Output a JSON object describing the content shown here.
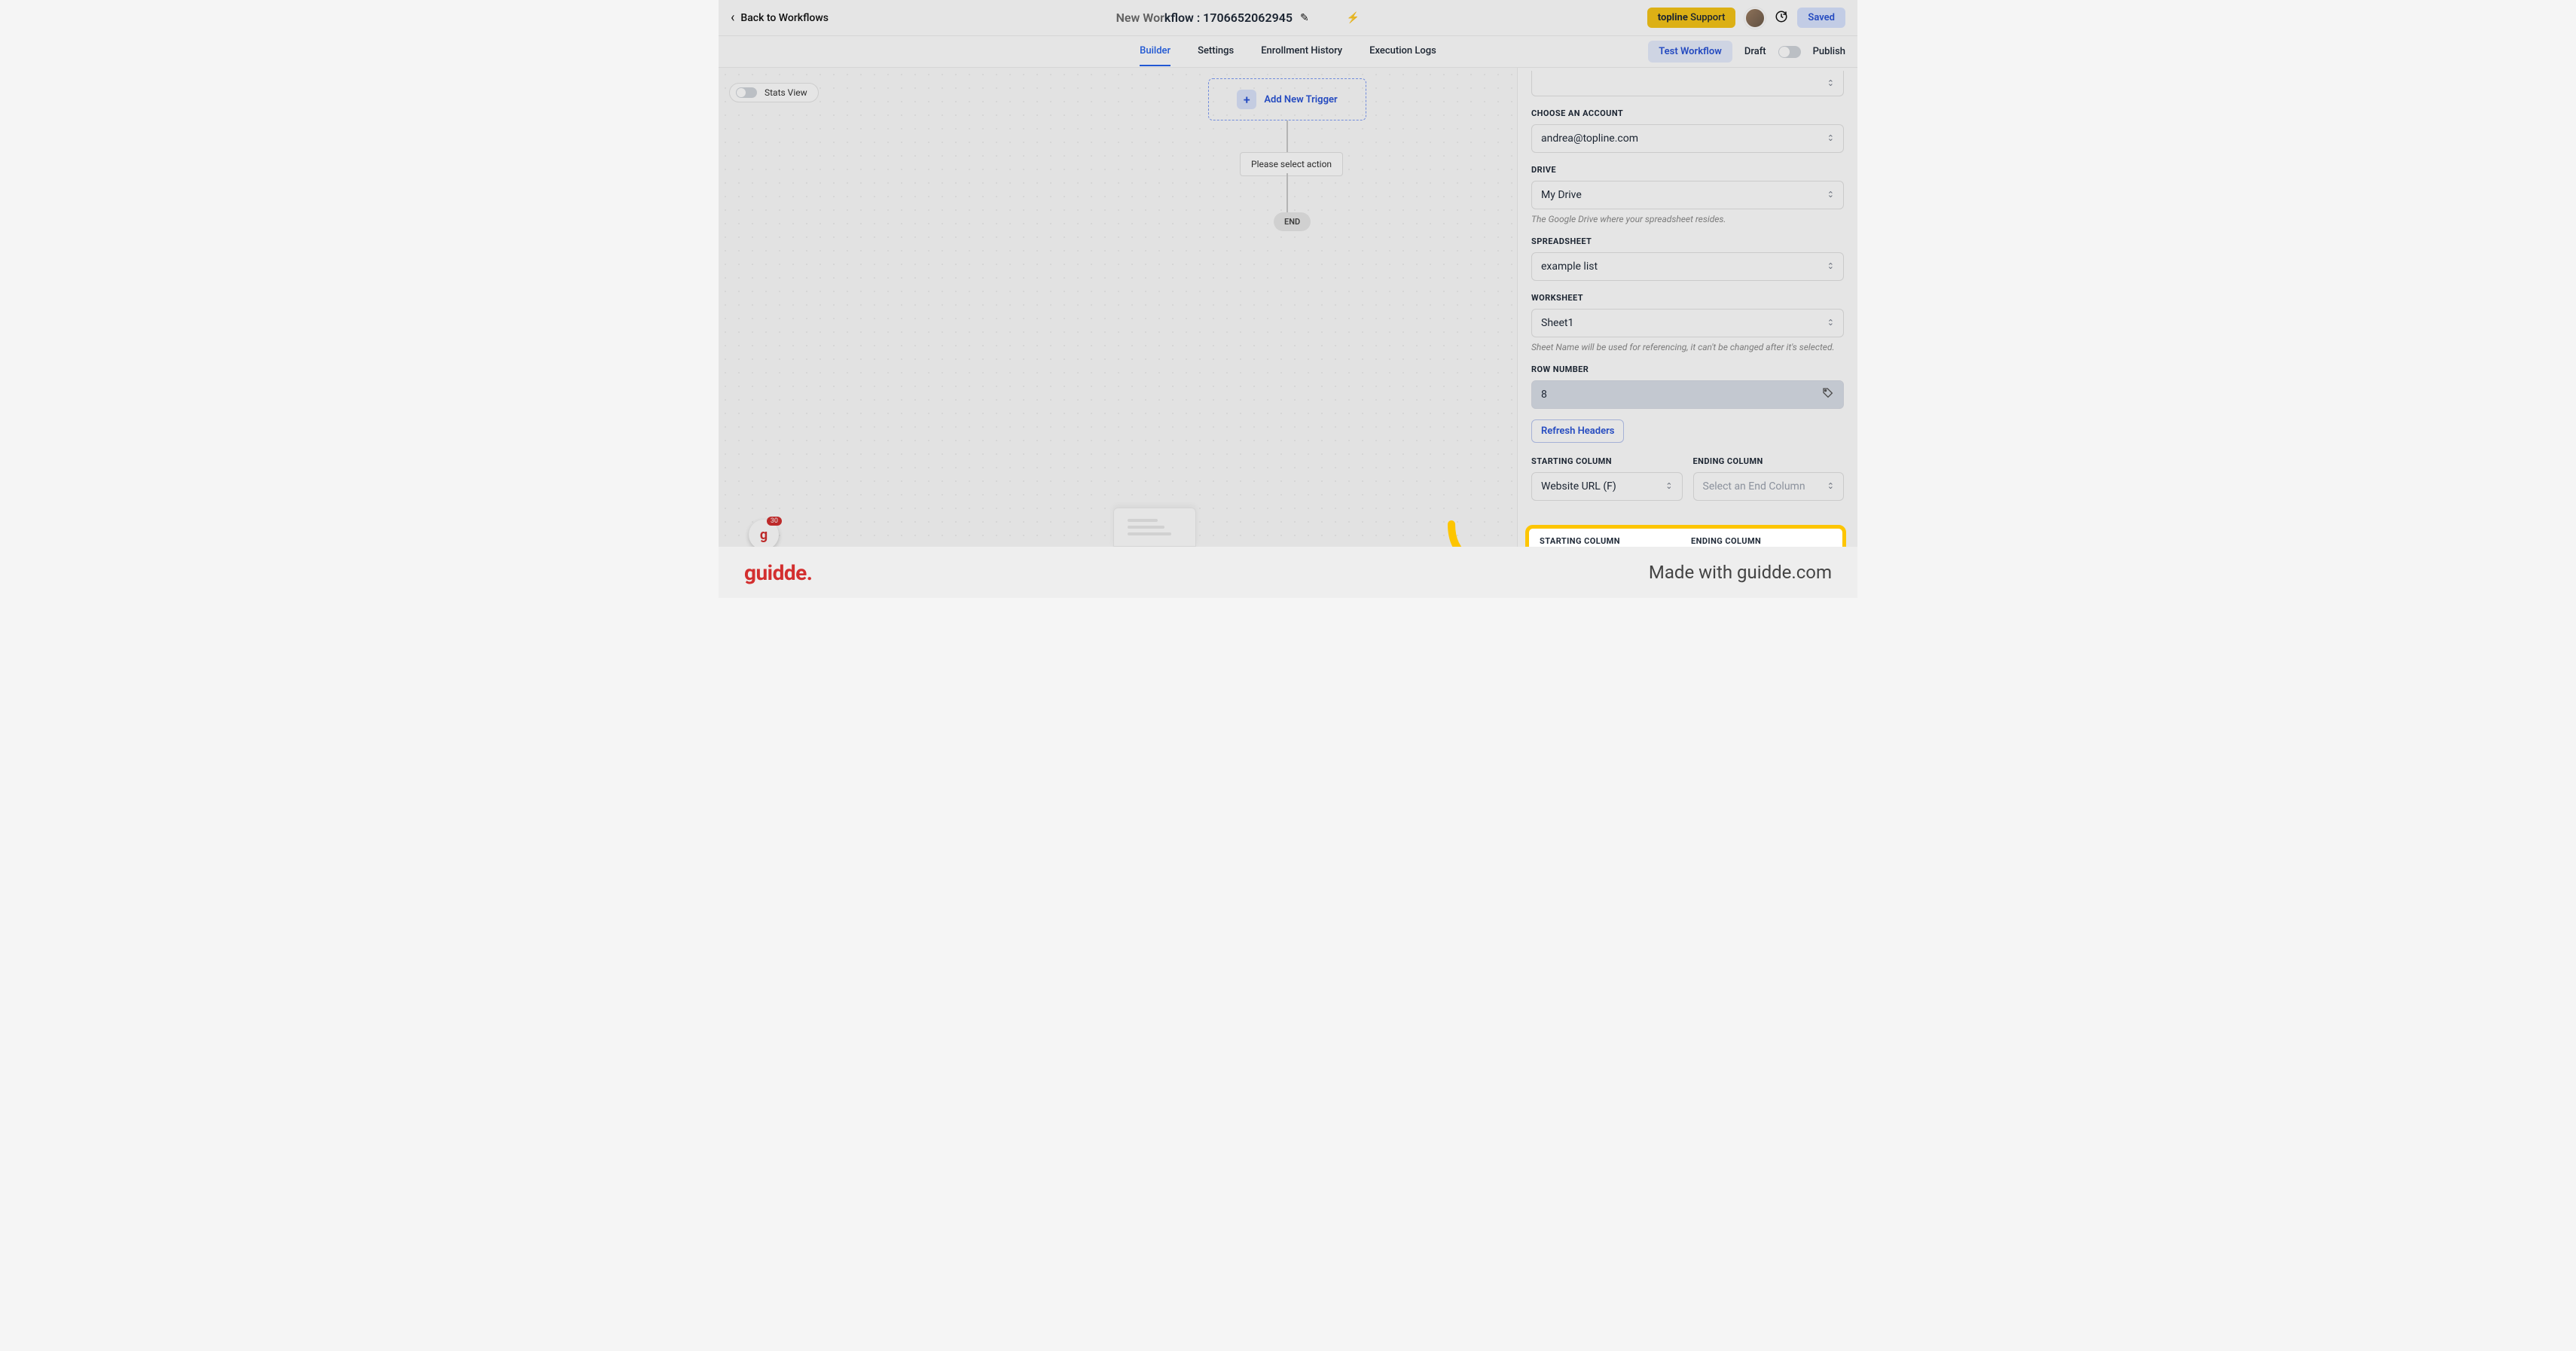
{
  "header": {
    "back_label": "Back to Workflows",
    "title_prefix": "New Wor",
    "title_rest": "kflow : 1706652062945",
    "support_label_bold": "topline",
    "support_label_rest": " Support",
    "saved_label": "Saved"
  },
  "tabs": {
    "builder": "Builder",
    "settings": "Settings",
    "enrollment_history": "Enrollment History",
    "execution_logs": "Execution Logs",
    "test_workflow": "Test Workflow",
    "draft": "Draft",
    "publish": "Publish"
  },
  "canvas": {
    "stats_view": "Stats View",
    "add_trigger": "Add New Trigger",
    "select_action": "Please select action",
    "end": "END",
    "widget_badge": "30"
  },
  "panel": {
    "choose_account_label": "CHOOSE AN ACCOUNT",
    "choose_account_value": "andrea@topline.com",
    "drive_label": "DRIVE",
    "drive_value": "My Drive",
    "drive_hint": "The Google Drive where your spreadsheet resides.",
    "spreadsheet_label": "SPREADSHEET",
    "spreadsheet_value": "example list",
    "worksheet_label": "WORKSHEET",
    "worksheet_value": "Sheet1",
    "worksheet_hint": "Sheet Name will be used for referencing, it can't be changed after it's selected.",
    "row_label": "ROW NUMBER",
    "row_value": "8",
    "refresh": "Refresh Headers",
    "starting_col_label": "STARTING COLUMN",
    "starting_col_value": "Website URL (F)",
    "ending_col_label": "ENDING COLUMN",
    "ending_col_placeholder": "Select an End Column"
  },
  "footer": {
    "logo": "guidde.",
    "made_with": "Made with guidde.com"
  }
}
